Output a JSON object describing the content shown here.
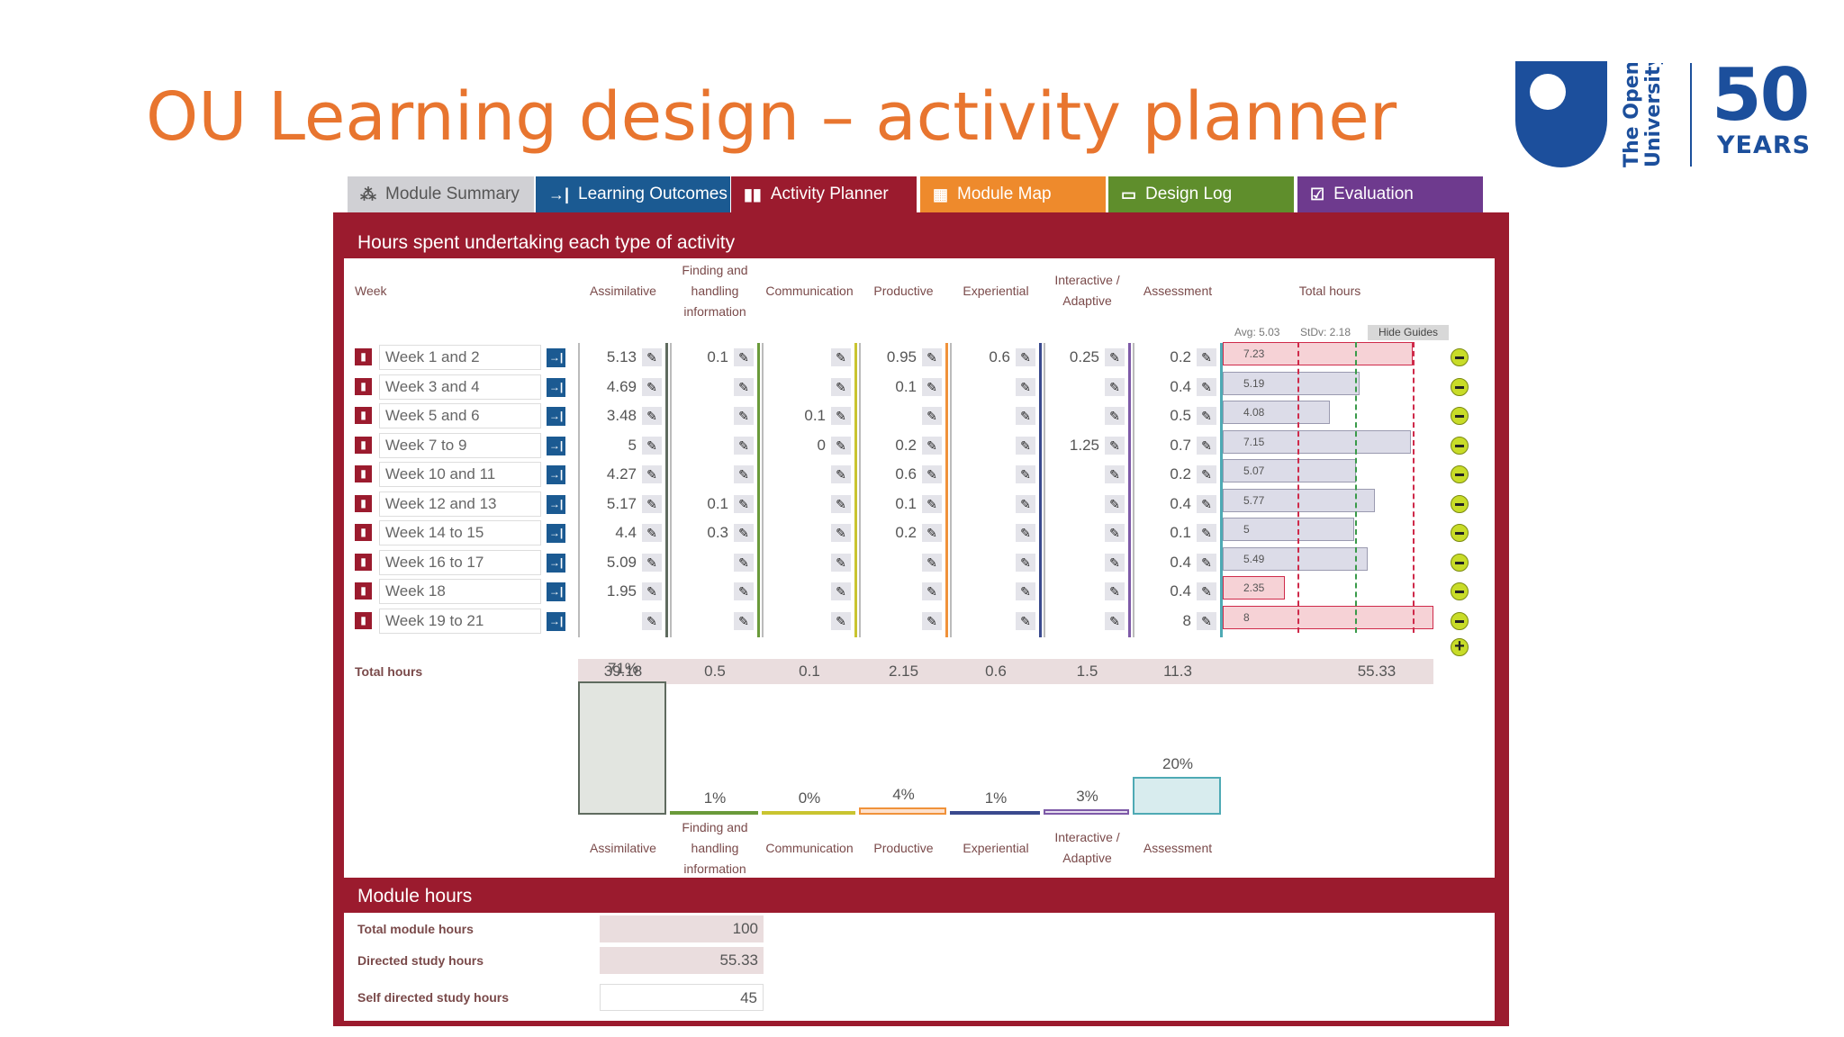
{
  "slide": {
    "title": "OU Learning design – activity planner"
  },
  "logo": {
    "ou_line1": "The Open",
    "ou_line2": "University",
    "fifty": "50",
    "years": "YEARS"
  },
  "tabs": [
    {
      "label": "Module Summary",
      "icon": "network-icon",
      "color": "#d0d0d4",
      "text_color": "#555555"
    },
    {
      "label": "Learning Outcomes",
      "icon": "arrow-to-line-icon",
      "color": "#1b5a92",
      "text_color": "#ffffff"
    },
    {
      "label": "Activity Planner",
      "icon": "bar-chart-icon",
      "color": "#9b1b2e",
      "text_color": "#ffffff"
    },
    {
      "label": "Module Map",
      "icon": "grid-icon",
      "color": "#ee8a2c",
      "text_color": "#ffffff"
    },
    {
      "label": "Design Log",
      "icon": "calendar-icon",
      "color": "#5f8e2c",
      "text_color": "#ffffff"
    },
    {
      "label": "Evaluation",
      "icon": "checkbox-icon",
      "color": "#6e3a8e",
      "text_color": "#ffffff"
    }
  ],
  "planner": {
    "section_title": "Hours spent undertaking each type of activity",
    "week_header": "Week",
    "total_hours_header": "Total hours",
    "avg_label": "Avg: 5.03",
    "stdev_label": "StDv: 2.18",
    "hide_guides": "Hide Guides",
    "columns": [
      {
        "label": "Assimilative",
        "color": "#5f6b5f"
      },
      {
        "label": "Finding and handling information",
        "color": "#6a9a3a"
      },
      {
        "label": "Communication",
        "color": "#c9c430"
      },
      {
        "label": "Productive",
        "color": "#f0923a"
      },
      {
        "label": "Experiential",
        "color": "#3a4a8e"
      },
      {
        "label": "Interactive / Adaptive",
        "color": "#7e5aa8"
      },
      {
        "label": "Assessment",
        "color": "#4eaab4"
      }
    ],
    "rows": [
      {
        "week": "Week 1 and 2",
        "values": [
          "5.13",
          "0.1",
          "",
          "0.95",
          "0.6",
          "0.25",
          "0.2"
        ],
        "total": "7.23"
      },
      {
        "week": "Week 3 and 4",
        "values": [
          "4.69",
          "",
          "",
          "0.1",
          "",
          "",
          "0.4"
        ],
        "total": "5.19"
      },
      {
        "week": "Week 5 and 6",
        "values": [
          "3.48",
          "",
          "0.1",
          "",
          "",
          "",
          "0.5"
        ],
        "total": "4.08"
      },
      {
        "week": "Week 7 to 9",
        "values": [
          "5",
          "",
          "0",
          "0.2",
          "",
          "1.25",
          "0.7"
        ],
        "total": "7.15"
      },
      {
        "week": "Week 10 and 11",
        "values": [
          "4.27",
          "",
          "",
          "0.6",
          "",
          "",
          "0.2"
        ],
        "total": "5.07"
      },
      {
        "week": "Week 12 and 13",
        "values": [
          "5.17",
          "0.1",
          "",
          "0.1",
          "",
          "",
          "0.4"
        ],
        "total": "5.77"
      },
      {
        "week": "Week 14 to 15",
        "values": [
          "4.4",
          "0.3",
          "",
          "0.2",
          "",
          "",
          "0.1"
        ],
        "total": "5"
      },
      {
        "week": "Week 16 to 17",
        "values": [
          "5.09",
          "",
          "",
          "",
          "",
          "",
          "0.4"
        ],
        "total": "5.49"
      },
      {
        "week": "Week 18",
        "values": [
          "1.95",
          "",
          "",
          "",
          "",
          "",
          "0.4"
        ],
        "total": "2.35"
      },
      {
        "week": "Week 19 to 21",
        "values": [
          "",
          "",
          "",
          "",
          "",
          "",
          "8"
        ],
        "total": "8"
      }
    ],
    "totals_label": "Total hours",
    "totals": [
      "39.18",
      "0.5",
      "0.1",
      "2.15",
      "0.6",
      "1.5",
      "11.3"
    ],
    "grand_total": "55.33",
    "percentages": [
      "71%",
      "1%",
      "0%",
      "4%",
      "1%",
      "3%",
      "20%"
    ]
  },
  "module_hours": {
    "section_title": "Module hours",
    "total_label": "Total module hours",
    "total_value": "100",
    "directed_label": "Directed study hours",
    "directed_value": "55.33",
    "self_label": "Self directed study hours",
    "self_value": "45"
  }
}
